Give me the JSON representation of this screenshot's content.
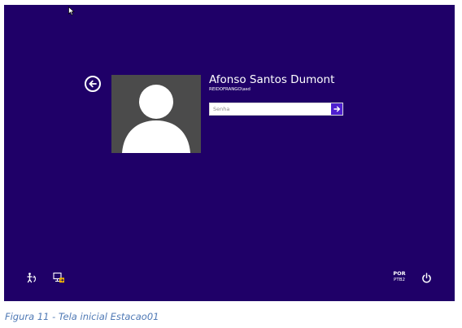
{
  "lock_screen": {
    "user": {
      "full_name": "Afonso Santos Dumont",
      "account": "REIDOFRANGO\\asd"
    },
    "password": {
      "placeholder": "Senha",
      "value": ""
    },
    "language": {
      "code": "POR",
      "keyboard": "PTB2"
    },
    "icons": {
      "back": "back-arrow-circle-icon",
      "submit": "arrow-right-icon",
      "ease_of_access": "ease-of-access-icon",
      "other_user": "switch-user-icon",
      "power": "power-icon",
      "cursor": "mouse-pointer-icon"
    },
    "colors": {
      "background": "#1f0068",
      "accent": "#4e1fd0",
      "avatar_bg": "#4b4b4b"
    }
  },
  "caption": {
    "text": "Figura 11 - Tela inicial Estacao01"
  }
}
